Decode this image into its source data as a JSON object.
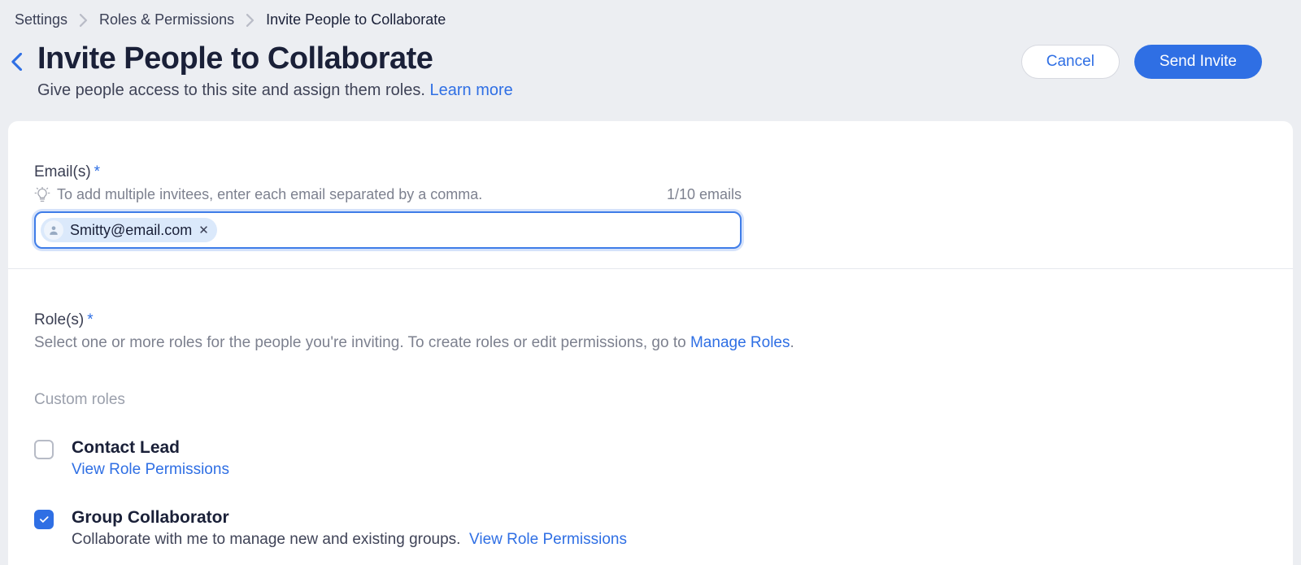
{
  "breadcrumb": {
    "items": [
      "Settings",
      "Roles & Permissions",
      "Invite People to Collaborate"
    ]
  },
  "header": {
    "title": "Invite People to Collaborate",
    "subtitle": "Give people access to this site and assign them roles.",
    "learn_more": "Learn more",
    "cancel_label": "Cancel",
    "send_label": "Send Invite"
  },
  "emails": {
    "label": "Email(s)",
    "hint": "To add multiple invitees, enter each email separated by a comma.",
    "count_text": "1/10 emails",
    "chips": [
      "Smitty@email.com"
    ]
  },
  "roles": {
    "label": "Role(s)",
    "help_prefix": "Select one or more roles for the people you're inviting. To create roles or edit permissions, go to ",
    "manage_link": "Manage Roles",
    "help_suffix": ".",
    "custom_label": "Custom roles",
    "items": [
      {
        "name": "Contact Lead",
        "desc": "",
        "checked": false,
        "view_link": "View Role Permissions"
      },
      {
        "name": "Group Collaborator",
        "desc": "Collaborate with me to manage new and existing groups.",
        "checked": true,
        "view_link": "View Role Permissions"
      }
    ]
  }
}
